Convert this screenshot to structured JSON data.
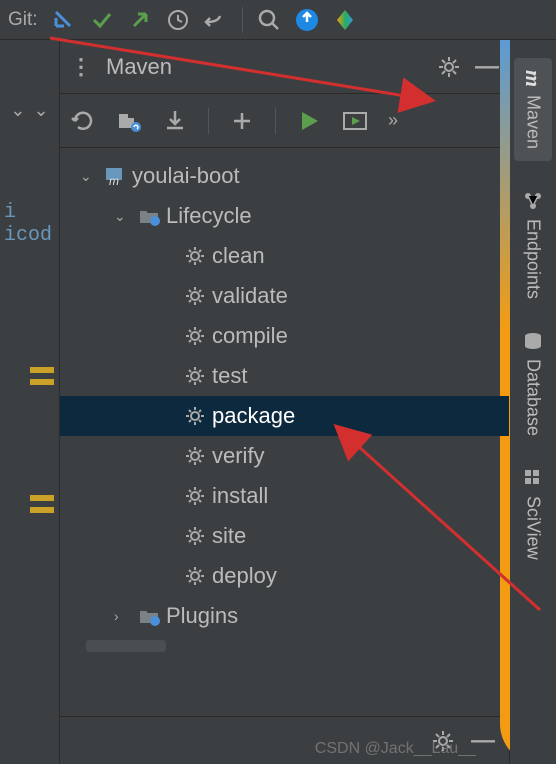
{
  "toolbar": {
    "git_label": "Git:"
  },
  "panel": {
    "title": "Maven",
    "project": "youlai-boot",
    "sections": {
      "lifecycle": "Lifecycle",
      "plugins": "Plugins"
    },
    "lifecycle_items": [
      "clean",
      "validate",
      "compile",
      "test",
      "package",
      "verify",
      "install",
      "site",
      "deploy"
    ],
    "selected": "package"
  },
  "right_tabs": {
    "maven": "Maven",
    "endpoints": "Endpoints",
    "database": "Database",
    "sciview": "SciView"
  },
  "left": {
    "code_snip": "i\nicod"
  },
  "watermark": "CSDN @Jack__Lau__"
}
